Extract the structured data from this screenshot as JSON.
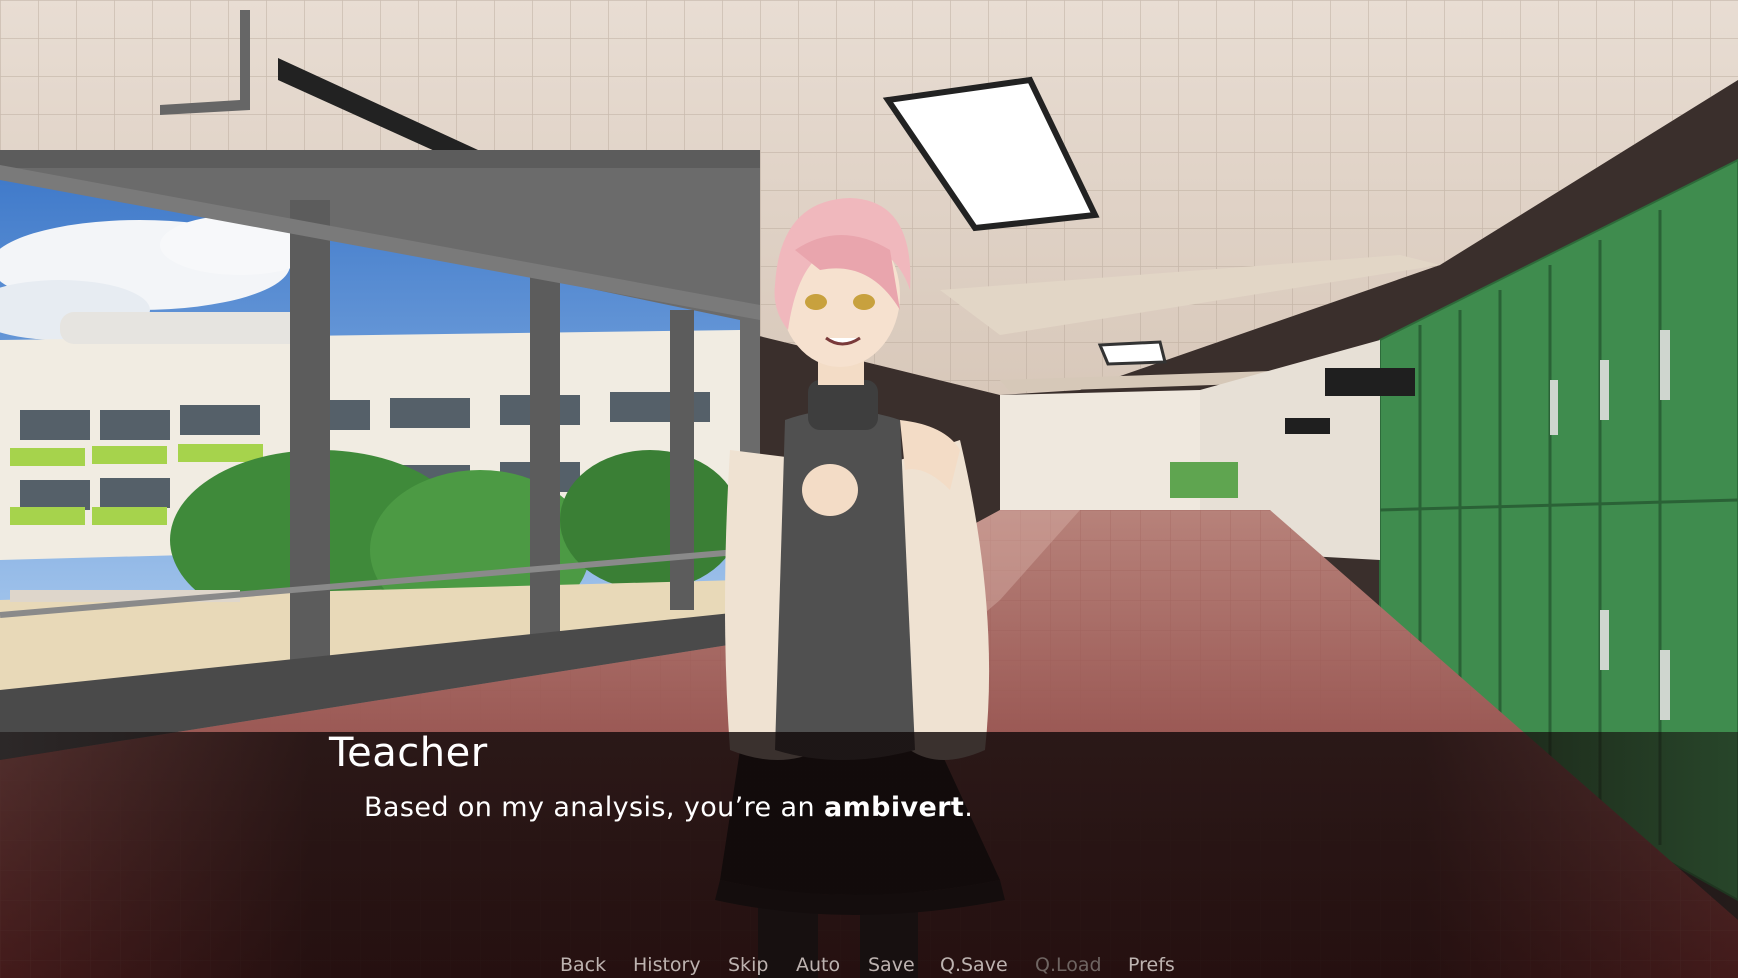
{
  "dialogue": {
    "speaker": "Teacher",
    "text_before": "Based on my analysis, you’re an ",
    "text_bold": "ambivert",
    "text_after": "."
  },
  "quick_menu": {
    "back": "Back",
    "history": "History",
    "skip": "Skip",
    "auto": "Auto",
    "save": "Save",
    "qsave": "Q.Save",
    "qload": "Q.Load",
    "prefs": "Prefs"
  },
  "colors": {
    "text": "#ffffff",
    "menu_text": "#bdb3b0",
    "menu_disabled": "#6f6562"
  }
}
